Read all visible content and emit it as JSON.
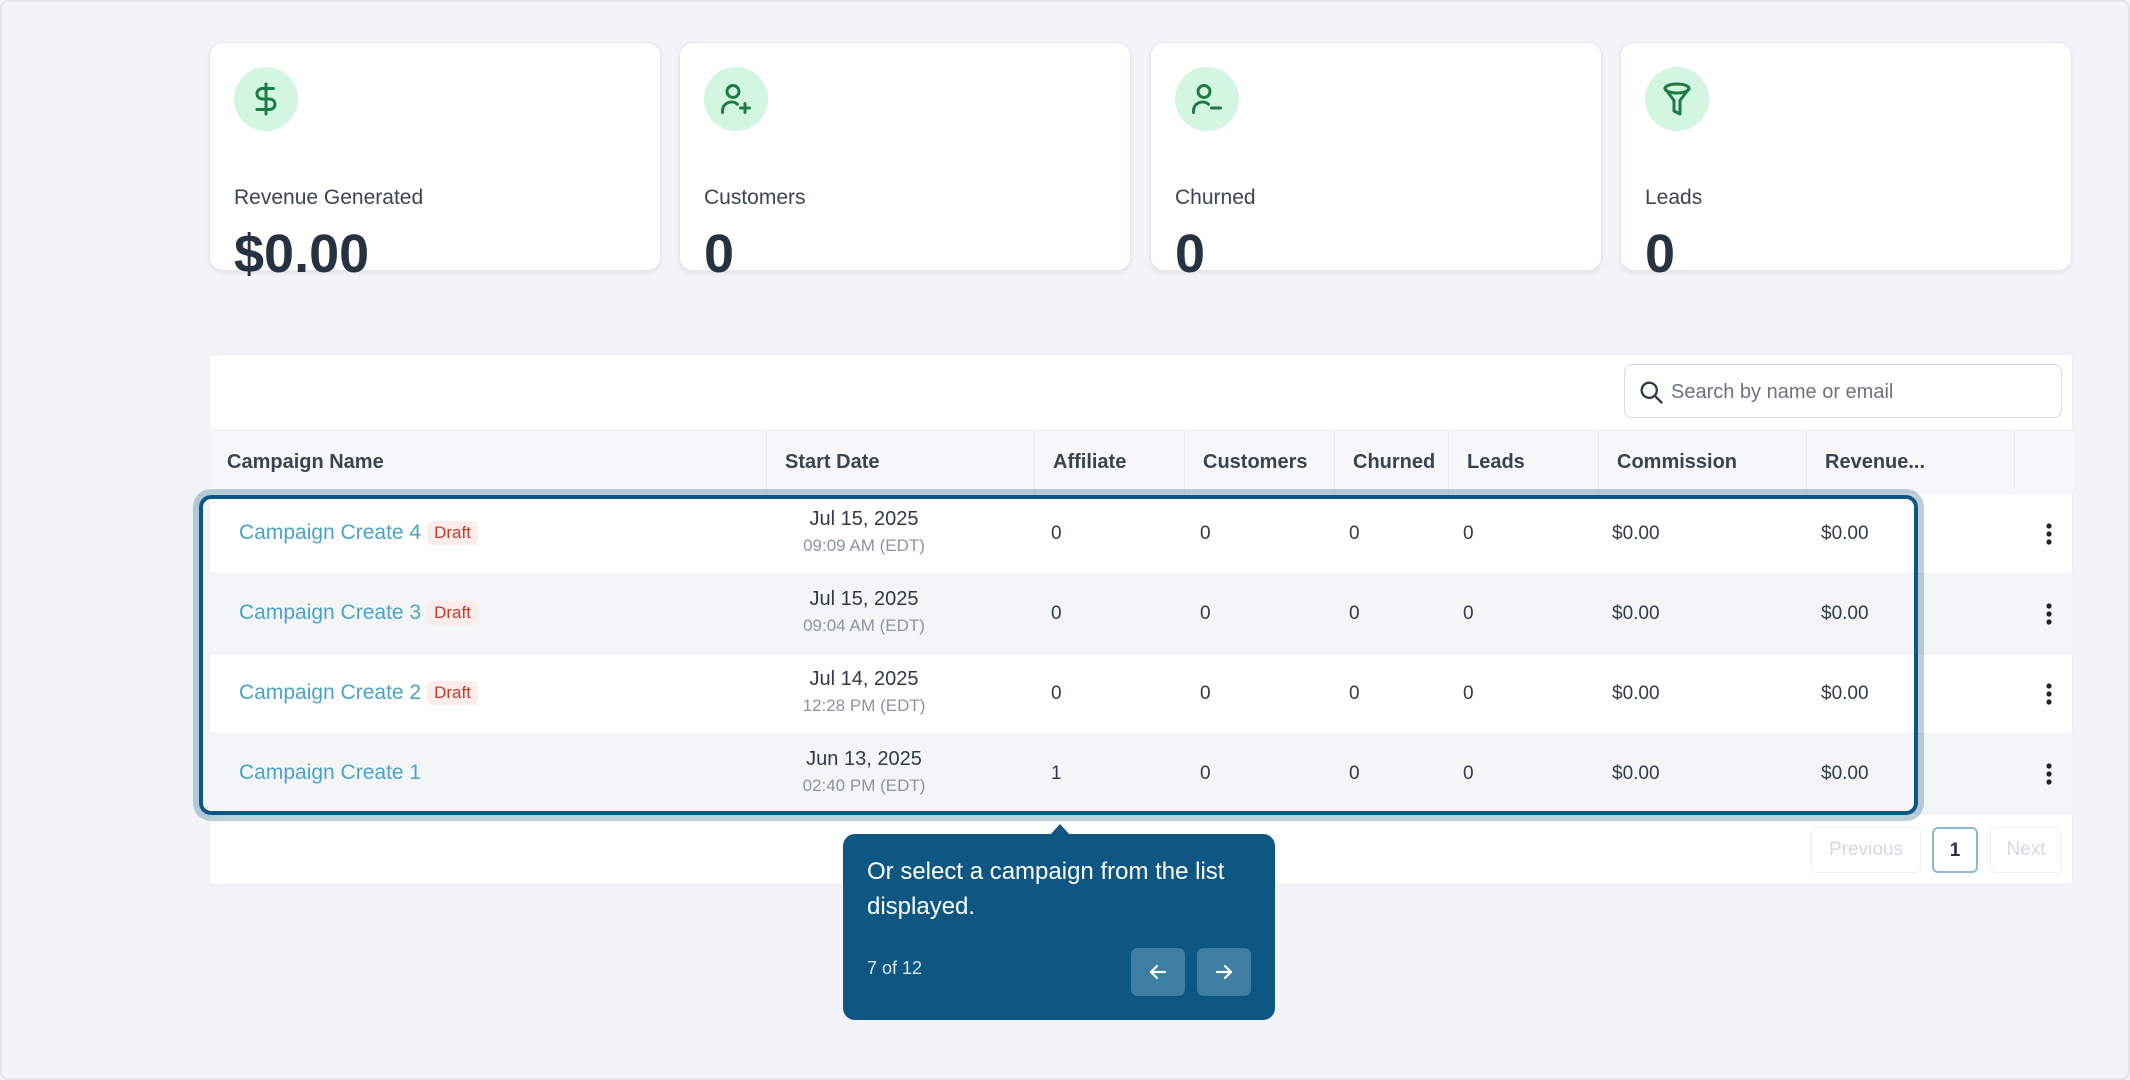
{
  "stats": [
    {
      "label": "Revenue Generated",
      "value": "$0.00",
      "icon": "dollar-icon"
    },
    {
      "label": "Customers",
      "value": "0",
      "icon": "user-plus-icon"
    },
    {
      "label": "Churned",
      "value": "0",
      "icon": "user-minus-icon"
    },
    {
      "label": "Leads",
      "value": "0",
      "icon": "funnel-icon"
    }
  ],
  "search": {
    "placeholder": "Search by name or email",
    "value": ""
  },
  "table": {
    "headers": [
      "Campaign Name",
      "Start Date",
      "Affiliate",
      "Customers",
      "Churned",
      "Leads",
      "Commission",
      "Revenue..."
    ],
    "rows": [
      {
        "name": "Campaign Create 4",
        "badge": "Draft",
        "date": "Jul 15, 2025",
        "time": "09:09 AM (EDT)",
        "affiliate": "0",
        "customers": "0",
        "churned": "0",
        "leads": "0",
        "commission": "$0.00",
        "revenue": "$0.00"
      },
      {
        "name": "Campaign Create 3",
        "badge": "Draft",
        "date": "Jul 15, 2025",
        "time": "09:04 AM (EDT)",
        "affiliate": "0",
        "customers": "0",
        "churned": "0",
        "leads": "0",
        "commission": "$0.00",
        "revenue": "$0.00"
      },
      {
        "name": "Campaign Create 2",
        "badge": "Draft",
        "date": "Jul 14, 2025",
        "time": "12:28 PM (EDT)",
        "affiliate": "0",
        "customers": "0",
        "churned": "0",
        "leads": "0",
        "commission": "$0.00",
        "revenue": "$0.00"
      },
      {
        "name": "Campaign Create 1",
        "badge": "",
        "date": "Jun 13, 2025",
        "time": "02:40 PM (EDT)",
        "affiliate": "1",
        "customers": "0",
        "churned": "0",
        "leads": "0",
        "commission": "$0.00",
        "revenue": "$0.00"
      }
    ]
  },
  "pagination": {
    "previous": "Previous",
    "page": "1",
    "next": "Next"
  },
  "tooltip": {
    "text": "Or select a campaign from the list displayed.",
    "step": "7 of 12"
  },
  "colors": {
    "accent": "#0e5783",
    "link": "#4aa3c4",
    "icon_bg": "#d2f6df",
    "icon_fg": "#1f7a45",
    "draft_bg": "#fdecec",
    "draft_fg": "#c0392b"
  }
}
